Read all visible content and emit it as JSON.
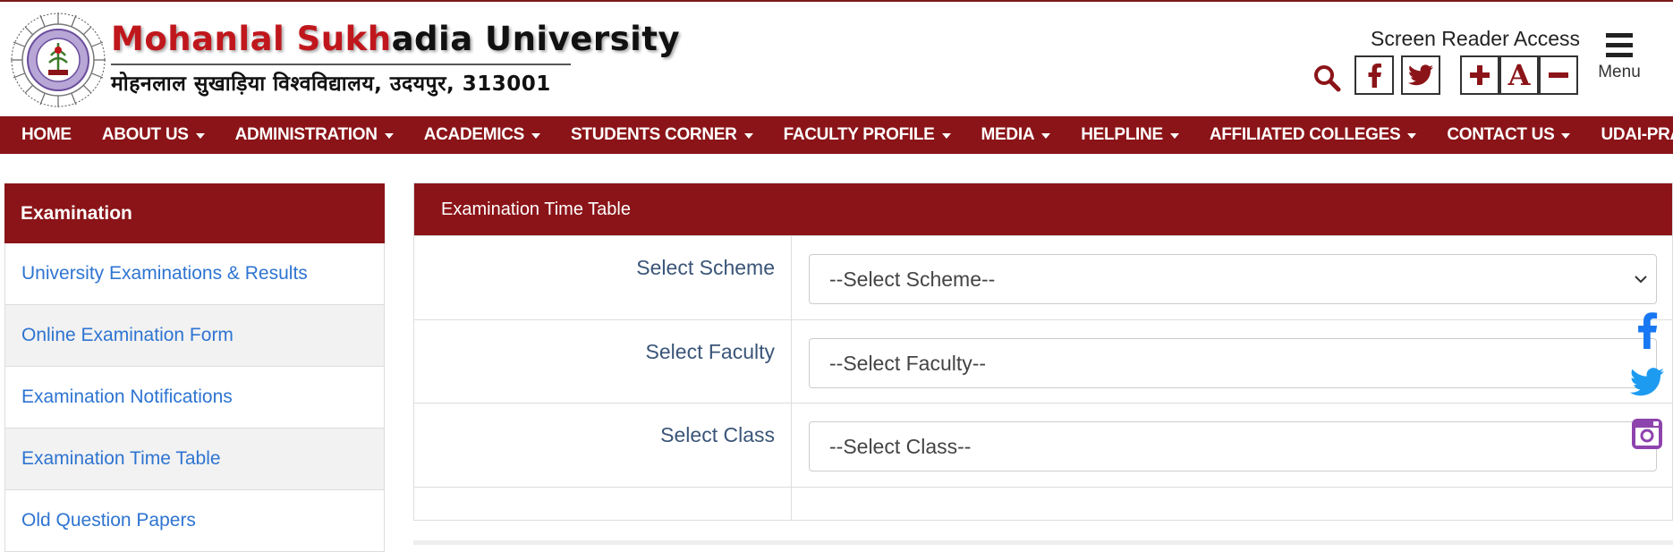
{
  "header": {
    "brand_en_part1": "Mohanlal",
    "brand_en_part2": "Sukh",
    "brand_en_part3": "adia University",
    "brand_hindi": "मोहनलाल सुखाड़िया विश्वविद्यालय, उदयपुर, 313001",
    "screen_reader_label": "Screen Reader Access",
    "menu_label": "Menu",
    "tools": [
      {
        "icon": "search-icon"
      },
      {
        "icon": "facebook-icon"
      },
      {
        "icon": "twitter-icon"
      },
      {
        "icon": "font-increase-icon"
      },
      {
        "icon": "font-reset-icon",
        "label": "A"
      },
      {
        "icon": "font-decrease-icon"
      }
    ]
  },
  "nav": {
    "items": [
      {
        "label": "HOME",
        "dropdown": false
      },
      {
        "label": "ABOUT US",
        "dropdown": true
      },
      {
        "label": "ADMINISTRATION",
        "dropdown": true
      },
      {
        "label": "ACADEMICS",
        "dropdown": true
      },
      {
        "label": "STUDENTS CORNER",
        "dropdown": true
      },
      {
        "label": "FACULTY PROFILE",
        "dropdown": true
      },
      {
        "label": "MEDIA",
        "dropdown": true
      },
      {
        "label": "HELPLINE",
        "dropdown": true
      },
      {
        "label": "AFFILIATED COLLEGES",
        "dropdown": true
      },
      {
        "label": "CONTACT US",
        "dropdown": true
      },
      {
        "label": "UDAI-PRABHA",
        "dropdown": false
      }
    ]
  },
  "sidebar": {
    "title": "Examination",
    "items": [
      {
        "label": "University Examinations & Results"
      },
      {
        "label": "Online Examination Form"
      },
      {
        "label": "Examination Notifications"
      },
      {
        "label": "Examination Time Table"
      },
      {
        "label": "Old Question Papers"
      }
    ]
  },
  "main": {
    "title": "Examination Time Table",
    "fields": [
      {
        "label": "Select Scheme",
        "value": "--Select Scheme--"
      },
      {
        "label": "Select Faculty",
        "value": "--Select Faculty--"
      },
      {
        "label": "Select Class",
        "value": "--Select Class--"
      }
    ]
  },
  "colors": {
    "brand_maroon": "#8b1418",
    "brand_red": "#c0171d",
    "link_blue": "#2e74d1",
    "instagram_purple": "#8e44ad",
    "facebook_blue": "#1877f2",
    "twitter_blue": "#1d9bf0"
  },
  "floating_social": [
    {
      "icon": "facebook-icon"
    },
    {
      "icon": "twitter-icon"
    },
    {
      "icon": "instagram-icon"
    }
  ]
}
